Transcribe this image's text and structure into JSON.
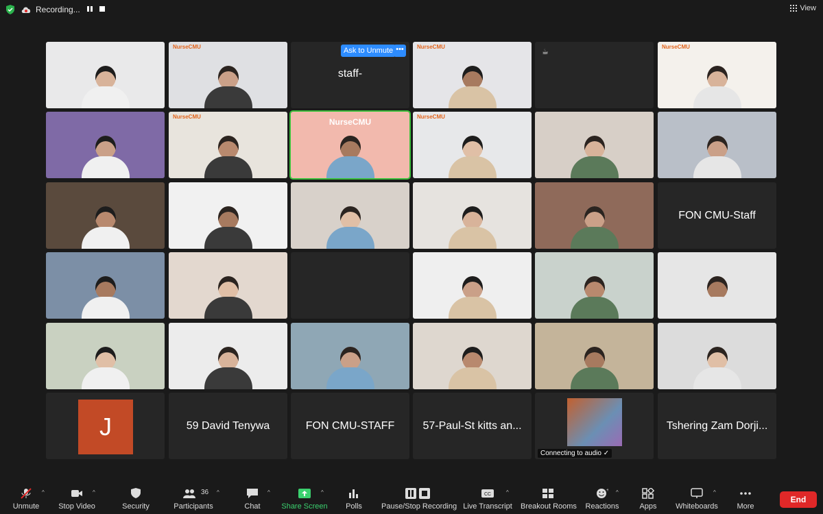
{
  "recording": {
    "label": "Recording..."
  },
  "view": {
    "label": "View"
  },
  "tiles": [
    {
      "name": "",
      "bg": "#e9e9ea"
    },
    {
      "name": "",
      "bg": "#dfe0e3",
      "brand": "NurseCMU"
    },
    {
      "name": "staff-",
      "bg": "#262626",
      "ask": "Ask to Unmute",
      "more": "•••"
    },
    {
      "name": "",
      "bg": "#e5e5e8",
      "brand": "NurseCMU"
    },
    {
      "name": "",
      "bg": "#262626",
      "cup": "☕"
    },
    {
      "name": "",
      "bg": "#f4f1ec",
      "brand": "NurseCMU"
    },
    {
      "name": "",
      "bg": "#7f6aa6"
    },
    {
      "name": "",
      "bg": "#e8e4dd",
      "brand": "NurseCMU"
    },
    {
      "name": "",
      "bg": "#f2b9ad",
      "banner": "NurseCMU"
    },
    {
      "name": "",
      "bg": "#e7e8ea",
      "brand": "NurseCMU"
    },
    {
      "name": "",
      "bg": "#d7cfc7"
    },
    {
      "name": "",
      "bg": "#b9bfc8"
    },
    {
      "name": "",
      "bg": "#5a4a3d"
    },
    {
      "name": "",
      "bg": "#f1f1f1"
    },
    {
      "name": "",
      "bg": "#d8d1ca"
    },
    {
      "name": "",
      "bg": "#e6e3df"
    },
    {
      "name": "",
      "bg": "#8f6a5a"
    },
    {
      "name": "FON CMU-Staff",
      "bg": "#262626"
    },
    {
      "name": "",
      "bg": "#7c8fa6"
    },
    {
      "name": "",
      "bg": "#e3d8cf"
    },
    {
      "name": "",
      "bg": "#262626"
    },
    {
      "name": "",
      "bg": "#efefef"
    },
    {
      "name": "",
      "bg": "#c9d2cc"
    },
    {
      "name": "",
      "bg": "#e6e6e6"
    },
    {
      "name": "",
      "bg": "#c9d1c1"
    },
    {
      "name": "",
      "bg": "#ececec"
    },
    {
      "name": "",
      "bg": "#8fa7b5"
    },
    {
      "name": "",
      "bg": "#ded7cf"
    },
    {
      "name": "",
      "bg": "#c4b49a"
    },
    {
      "name": "",
      "bg": "#dcdcdc"
    },
    {
      "name": "J",
      "bg": "#262626",
      "avatar": "J"
    },
    {
      "name": "59 David  Tenywa",
      "bg": "#262626"
    },
    {
      "name": "FON CMU-STAFF",
      "bg": "#262626"
    },
    {
      "name": "57-Paul-St kitts an...",
      "bg": "#262626"
    },
    {
      "name": "",
      "bg": "#262626",
      "connecting": "Connecting to audio  ✓"
    },
    {
      "name": "Tshering Zam Dorji...",
      "bg": "#262626"
    }
  ],
  "toolbar": {
    "unmute": "Unmute",
    "stop_video": "Stop Video",
    "security": "Security",
    "participants": "Participants",
    "participants_count": "36",
    "chat": "Chat",
    "share_screen": "Share Screen",
    "polls": "Polls",
    "pause_recording": "Pause/Stop Recording",
    "live_transcript": "Live Transcript",
    "breakout_rooms": "Breakout Rooms",
    "reactions": "Reactions",
    "apps": "Apps",
    "whiteboards": "Whiteboards",
    "more": "More",
    "end": "End"
  }
}
